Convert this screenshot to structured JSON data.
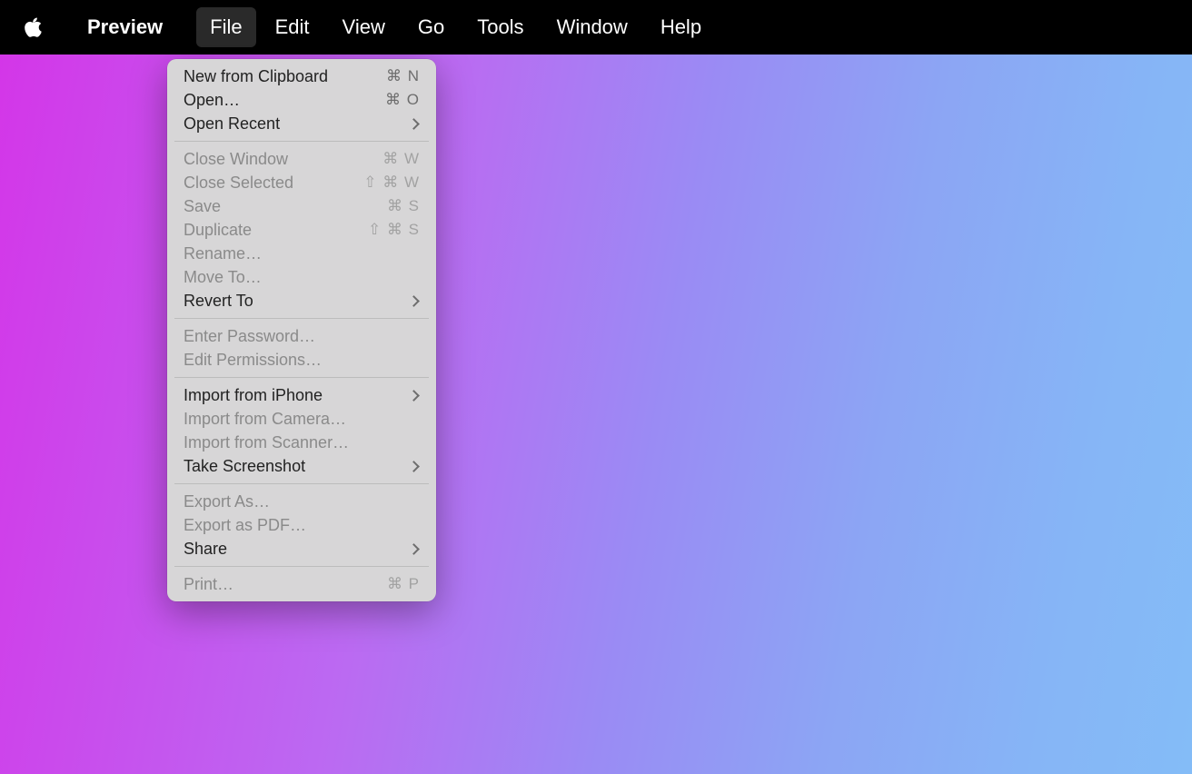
{
  "menubar": {
    "app_name": "Preview",
    "items": [
      "File",
      "Edit",
      "View",
      "Go",
      "Tools",
      "Window",
      "Help"
    ],
    "active_index": 0
  },
  "file_menu": {
    "groups": [
      [
        {
          "label": "New from Clipboard",
          "shortcut": "⌘ N",
          "enabled": true,
          "submenu": false
        },
        {
          "label": "Open…",
          "shortcut": "⌘ O",
          "enabled": true,
          "submenu": false
        },
        {
          "label": "Open Recent",
          "shortcut": "",
          "enabled": true,
          "submenu": true
        }
      ],
      [
        {
          "label": "Close Window",
          "shortcut": "⌘ W",
          "enabled": false,
          "submenu": false
        },
        {
          "label": "Close Selected",
          "shortcut": "⇧ ⌘ W",
          "enabled": false,
          "submenu": false
        },
        {
          "label": "Save",
          "shortcut": "⌘ S",
          "enabled": false,
          "submenu": false
        },
        {
          "label": "Duplicate",
          "shortcut": "⇧ ⌘ S",
          "enabled": false,
          "submenu": false
        },
        {
          "label": "Rename…",
          "shortcut": "",
          "enabled": false,
          "submenu": false
        },
        {
          "label": "Move To…",
          "shortcut": "",
          "enabled": false,
          "submenu": false
        },
        {
          "label": "Revert To",
          "shortcut": "",
          "enabled": true,
          "submenu": true
        }
      ],
      [
        {
          "label": "Enter Password…",
          "shortcut": "",
          "enabled": false,
          "submenu": false
        },
        {
          "label": "Edit Permissions…",
          "shortcut": "",
          "enabled": false,
          "submenu": false
        }
      ],
      [
        {
          "label": "Import from iPhone",
          "shortcut": "",
          "enabled": true,
          "submenu": true
        },
        {
          "label": "Import from Camera…",
          "shortcut": "",
          "enabled": false,
          "submenu": false
        },
        {
          "label": "Import from Scanner…",
          "shortcut": "",
          "enabled": false,
          "submenu": false
        },
        {
          "label": "Take Screenshot",
          "shortcut": "",
          "enabled": true,
          "submenu": true
        }
      ],
      [
        {
          "label": "Export As…",
          "shortcut": "",
          "enabled": false,
          "submenu": false
        },
        {
          "label": "Export as PDF…",
          "shortcut": "",
          "enabled": false,
          "submenu": false
        },
        {
          "label": "Share",
          "shortcut": "",
          "enabled": true,
          "submenu": true
        }
      ],
      [
        {
          "label": "Print…",
          "shortcut": "⌘ P",
          "enabled": false,
          "submenu": false
        }
      ]
    ]
  }
}
